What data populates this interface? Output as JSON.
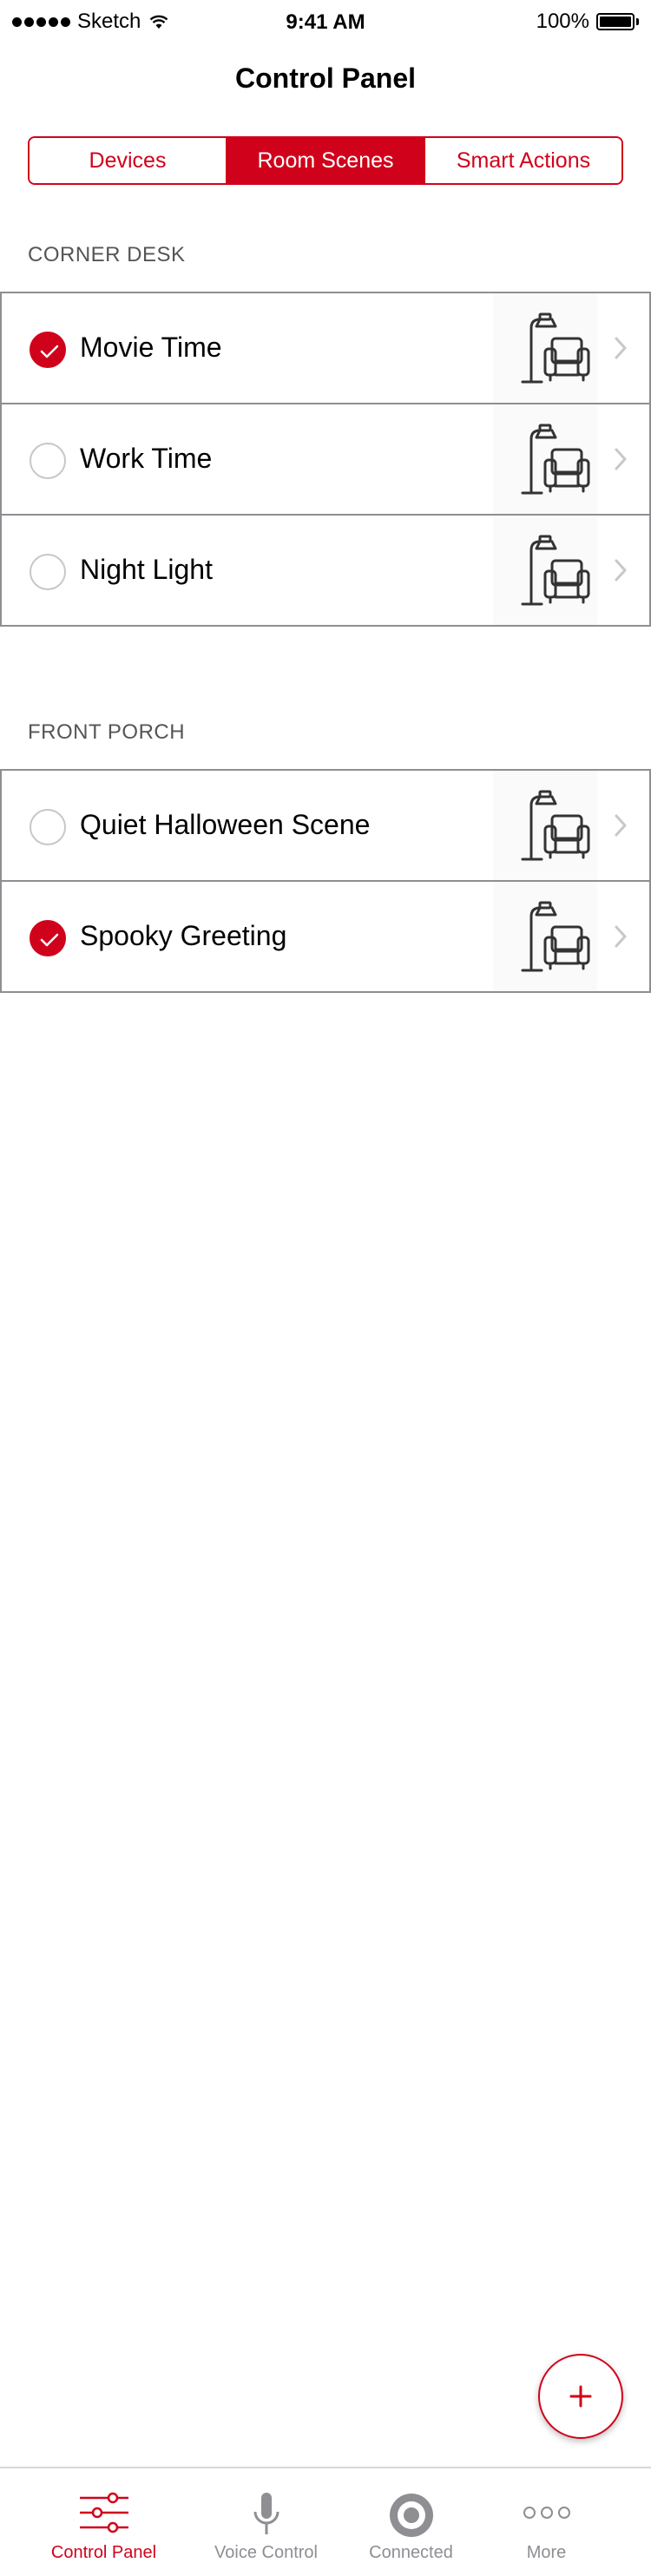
{
  "status_bar": {
    "carrier": "Sketch",
    "time": "9:41 AM",
    "battery": "100%"
  },
  "nav": {
    "title": "Control Panel"
  },
  "segments": [
    {
      "label": "Devices",
      "active": false
    },
    {
      "label": "Room Scenes",
      "active": true
    },
    {
      "label": "Smart Actions",
      "active": false
    }
  ],
  "sections": [
    {
      "header": "CORNER DESK",
      "scenes": [
        {
          "name": "Movie Time",
          "checked": true,
          "icon": "lamp-armchair-icon"
        },
        {
          "name": "Work Time",
          "checked": false,
          "icon": "lamp-armchair-icon"
        },
        {
          "name": "Night Light",
          "checked": false,
          "icon": "lamp-armchair-icon"
        }
      ]
    },
    {
      "header": "FRONT PORCH",
      "scenes": [
        {
          "name": "Quiet Halloween Scene",
          "checked": false,
          "icon": "lamp-armchair-icon"
        },
        {
          "name": "Spooky Greeting",
          "checked": true,
          "icon": "lamp-armchair-icon"
        }
      ]
    }
  ],
  "fab": {
    "icon": "plus-icon"
  },
  "tab_bar": [
    {
      "label": "Control Panel",
      "icon": "sliders-icon",
      "active": true
    },
    {
      "label": "Voice Control",
      "icon": "microphone-icon",
      "active": false
    },
    {
      "label": "Connected",
      "icon": "target-icon",
      "active": false
    },
    {
      "label": "More",
      "icon": "more-dots-icon",
      "active": false
    }
  ],
  "colors": {
    "accent": "#d0021b",
    "separator": "#8e8e93",
    "inactive": "#8e8e93"
  }
}
